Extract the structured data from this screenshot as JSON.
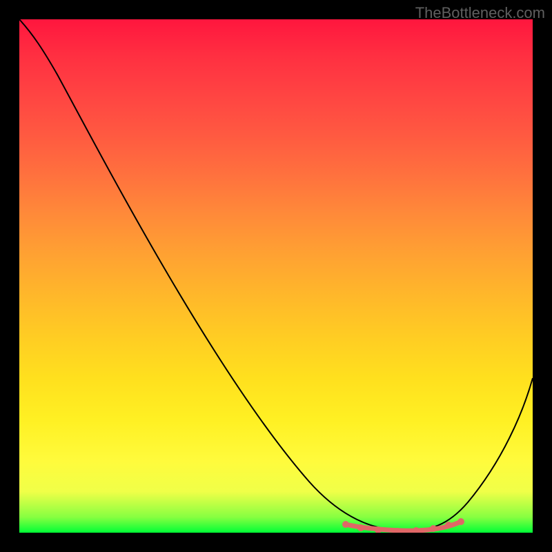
{
  "watermark": "TheBottleneck.com",
  "chart_data": {
    "type": "line",
    "title": "",
    "xlabel": "",
    "ylabel": "",
    "xlim": [
      0,
      100
    ],
    "ylim": [
      0,
      100
    ],
    "grid": false,
    "series": [
      {
        "name": "bottleneck-curve",
        "x": [
          0,
          5,
          10,
          15,
          20,
          25,
          30,
          35,
          40,
          45,
          50,
          55,
          58,
          62,
          66,
          70,
          74,
          78,
          82,
          86,
          90,
          94,
          97,
          100
        ],
        "y": [
          100,
          97,
          92,
          85,
          77,
          69,
          60,
          52,
          44,
          36,
          28,
          20,
          15,
          10,
          6,
          3,
          1,
          0,
          0,
          2,
          6,
          14,
          22,
          30
        ]
      }
    ],
    "highlighted_region": {
      "name": "optimal-zone",
      "x_range": [
        64,
        86
      ],
      "y_level": 1
    },
    "gradient": {
      "top_color": "#ff163e",
      "bottom_color": "#00ff36"
    }
  }
}
